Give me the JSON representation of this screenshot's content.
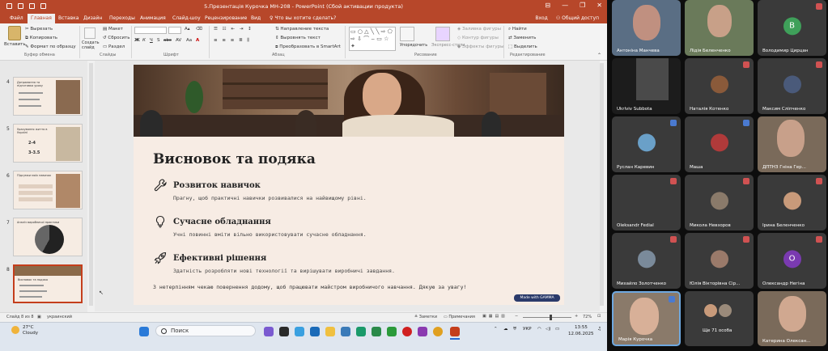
{
  "app": {
    "title": "5.Презентація Курочка МН-208 - PowerPoint (Сбой активации продукта)",
    "quick_access": [
      "save-icon",
      "undo-icon",
      "redo-icon",
      "start-icon"
    ],
    "window_controls": [
      "⊟",
      "—",
      "❐",
      "✕"
    ]
  },
  "tabs": [
    {
      "label": "Файл"
    },
    {
      "label": "Главная",
      "active": true
    },
    {
      "label": "Вставка"
    },
    {
      "label": "Дизайн"
    },
    {
      "label": "Переходы"
    },
    {
      "label": "Анимация"
    },
    {
      "label": "Слайд-шоу"
    },
    {
      "label": "Рецензирование"
    },
    {
      "label": "Вид"
    },
    {
      "label": "Что вы хотите сделать?"
    }
  ],
  "account": {
    "signin": "Вход",
    "share": "Общий доступ"
  },
  "ribbon": {
    "clipboard": {
      "paste": "Вставить",
      "cut": "Вырезать",
      "copy": "Копировать",
      "format_painter": "Формат по образцу",
      "group": "Буфер обмена"
    },
    "slides": {
      "new_slide": "Создать слайд",
      "layout": "Макет",
      "reset": "Сбросить",
      "section": "Раздел",
      "group": "Слайды"
    },
    "font": {
      "name": "",
      "size": "",
      "group": "Шрифт",
      "buttons": [
        "Ж",
        "К",
        "Ч",
        "S",
        "abc",
        "AV",
        "Aa",
        "A"
      ]
    },
    "paragraph": {
      "text_direction": "Направление текста",
      "align_text": "Выровнять текст",
      "smartart": "Преобразовать в SmartArt",
      "group": "Абзац"
    },
    "drawing": {
      "arrange": "Упорядочить",
      "quick_styles": "Экспресс-стили",
      "fill": "Заливка фигуры",
      "outline": "Контур фигуры",
      "effects": "Эффекты фигуры",
      "group": "Рисование"
    },
    "editing": {
      "find": "Найти",
      "replace": "Заменить",
      "select": "Выделить",
      "group": "Редактирование"
    }
  },
  "thumbnails": [
    {
      "num": "4",
      "title": "Дотримання та підготовка уроку"
    },
    {
      "num": "5",
      "title": "Урахування життя в Україні",
      "stats": [
        "2-4",
        "3-3.5"
      ]
    },
    {
      "num": "6",
      "title": "Підсумки моїх навичок"
    },
    {
      "num": "7",
      "title": "Аналіз виробничої практики"
    },
    {
      "num": "8",
      "title": "Висновок та подяка",
      "selected": true
    }
  ],
  "slide": {
    "title": "Висновок та подяка",
    "items": [
      {
        "icon": "wrench-icon",
        "heading": "Розвиток навичок",
        "text": "Прагну, щоб практичні навички розвивалися на найвищому рівні."
      },
      {
        "icon": "lightbulb-icon",
        "heading": "Сучасне обладнання",
        "text": "Учні повинні вміти вільно використовувати сучасне обладнання."
      },
      {
        "icon": "rocket-icon",
        "heading": "Ефективні рішення",
        "text": "Здатність розробляти нові технології та вирішувати виробничі завдання."
      }
    ],
    "closing": "З нетерпінням чекаю повернення додому, щоб працювати майстром виробничого навчання. Дякую за увагу!",
    "badge": "Made with GAMMA"
  },
  "status": {
    "slide": "Слайд 8 из 8",
    "language": "украинский",
    "notes": "Заметки",
    "comments": "Примечания",
    "zoom": "72%"
  },
  "taskbar": {
    "weather_temp": "27°C",
    "weather_desc": "Cloudy",
    "search": "Поиск",
    "lang": "УКР",
    "time": "13:55",
    "date": "12.06.2025"
  },
  "participants": [
    {
      "name": "Антоніна Манчева",
      "color": "#4a6a8a",
      "initial": "",
      "mic_off": false
    },
    {
      "name": "Лідія Беленченко",
      "color": "#5a7a4a",
      "initial": "",
      "mic_off": false
    },
    {
      "name": "Володимир Цирцан",
      "color": "#3a3a3a",
      "initial": "В",
      "avatar_color": "#3fa05a",
      "mic_off": true
    },
    {
      "name": "Ukrlviv Subbota",
      "color": "#222222",
      "initial": "",
      "mic_off": false
    },
    {
      "name": "Наталія Котенко",
      "color": "#3a3a3a",
      "initial": "",
      "avatar_color": "#8a5a3a",
      "mic_off": true
    },
    {
      "name": "Максим Сліпченко",
      "color": "#3a3a3a",
      "initial": "",
      "avatar_color": "#4a5a7a",
      "mic_off": true
    },
    {
      "name": "Руслан Каревин",
      "color": "#3a3a3a",
      "initial": "",
      "avatar_color": "#6aa0c8",
      "mic_off": false
    },
    {
      "name": "Маша",
      "color": "#3a3a3a",
      "initial": "",
      "avatar_color": "#b03a3a",
      "mic_off": false
    },
    {
      "name": "ДПТНЗ Гніна Гер...",
      "color": "#7a6a5a",
      "initial": "",
      "mic_off": false
    },
    {
      "name": "Oleksandr Fedial",
      "color": "#3a3a3a",
      "initial": "",
      "mic_off": true
    },
    {
      "name": "Микола Невзоров",
      "color": "#3a3a3a",
      "initial": "",
      "avatar_color": "#8a7a6a",
      "mic_off": true
    },
    {
      "name": "Ірина Беленченко",
      "color": "#3a3a3a",
      "initial": "",
      "avatar_color": "#c89a7a",
      "mic_off": true
    },
    {
      "name": "Михайло Золотченко",
      "color": "#3a3a3a",
      "initial": "",
      "avatar_color": "#7a8a9a",
      "mic_off": true
    },
    {
      "name": "Юлія Вікторівна Сір...",
      "color": "#3a3a3a",
      "initial": "",
      "avatar_color": "#9a7a6a",
      "mic_off": true
    },
    {
      "name": "Олександр Негіна",
      "color": "#3a3a3a",
      "initial": "О",
      "avatar_color": "#7a3ab0",
      "mic_off": true
    },
    {
      "name": "Марія Курочка",
      "color": "#8a7a6a",
      "initial": "",
      "mic_off": false,
      "speaking": true
    },
    {
      "name": "Ще 71 особа",
      "color": "#3a3a3a",
      "initial": "",
      "mic_off": false
    },
    {
      "name": "Катерина Олексан...",
      "color": "#7a6a5a",
      "initial": "",
      "mic_off": false
    }
  ],
  "colors": {
    "ppt_red": "#b7472a",
    "slide_bg": "#f7ece4",
    "active_speaker": "#6ea8e0"
  }
}
